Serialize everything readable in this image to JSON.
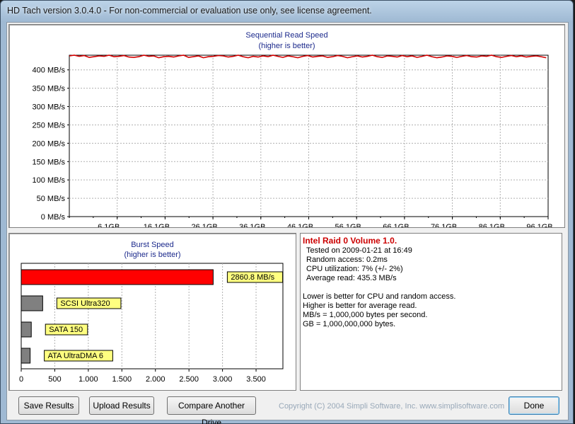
{
  "window": {
    "title": "HD Tach version 3.0.4.0  - For non-commercial or evaluation use only, see license agreement."
  },
  "read_chart": {
    "title": "Sequential Read Speed",
    "subtitle": "(higher is better)",
    "y_ticks": [
      "0 MB/s",
      "50 MB/s",
      "100 MB/s",
      "150 MB/s",
      "200 MB/s",
      "250 MB/s",
      "300 MB/s",
      "350 MB/s",
      "400 MB/s"
    ],
    "x_ticks": [
      "6,1GB",
      "16,1GB",
      "26,1GB",
      "36,1GB",
      "46,1GB",
      "56,1GB",
      "66,1GB",
      "76,1GB",
      "86,1GB",
      "96,1GB"
    ]
  },
  "burst_chart": {
    "title": "Burst Speed",
    "subtitle": "(higher is better)",
    "x_ticks": [
      "0",
      "500",
      "1.000",
      "1.500",
      "2.000",
      "2.500",
      "3.000",
      "3.500"
    ]
  },
  "chart_data": [
    {
      "type": "line",
      "title": "Sequential Read Speed",
      "subtitle": "(higher is better)",
      "ylim": [
        0,
        440
      ],
      "y_unit": "MB/s",
      "x_unit": "GB",
      "xlim": [
        0,
        96.1
      ],
      "series": [
        {
          "color": "#d40000",
          "x": [
            0,
            1,
            2,
            3,
            4,
            5,
            6,
            7,
            8,
            9,
            10,
            11,
            12,
            13,
            14,
            15,
            16,
            17,
            18,
            19,
            20,
            21,
            22,
            23,
            24,
            25,
            26,
            27,
            28,
            29,
            30,
            31,
            32,
            33,
            34,
            35,
            36,
            37,
            38,
            39,
            40,
            41,
            42,
            43,
            44,
            45,
            46,
            47,
            48,
            49,
            50,
            51,
            52,
            53,
            54,
            55,
            56,
            57,
            58,
            59,
            60,
            61,
            62,
            63,
            64,
            65,
            66,
            67,
            68,
            69,
            70,
            71,
            72,
            73,
            74,
            75,
            76,
            77,
            78,
            79,
            80,
            81,
            82,
            83,
            84,
            85,
            86,
            87,
            88,
            89,
            90,
            91,
            92,
            93,
            94,
            95,
            96
          ],
          "values": [
            438,
            440,
            437,
            439,
            434,
            436,
            438,
            437,
            440,
            436,
            437,
            439,
            435,
            434,
            436,
            440,
            437,
            438,
            433,
            436,
            437,
            435,
            438,
            440,
            434,
            436,
            438,
            433,
            436,
            437,
            439,
            438,
            435,
            437,
            440,
            436,
            433,
            437,
            435,
            438,
            436,
            440,
            437,
            434,
            438,
            436,
            433,
            437,
            439,
            435,
            437,
            438,
            434,
            436,
            439,
            437,
            433,
            436,
            438,
            435,
            437,
            440,
            436,
            434,
            438,
            437,
            435,
            439,
            436,
            438,
            434,
            437,
            440,
            436,
            433,
            435,
            438,
            437,
            434,
            437,
            439,
            436,
            435,
            438,
            437,
            440,
            436,
            434,
            437,
            439,
            436,
            438,
            435,
            437,
            438,
            436,
            433
          ]
        }
      ]
    },
    {
      "type": "bar",
      "title": "Burst Speed",
      "subtitle": "(higher is better)",
      "orientation": "horizontal",
      "xlim": [
        0,
        3900
      ],
      "categories": [
        "2860.8 MB/s",
        "SCSI Ultra320",
        "SATA 150",
        "ATA UltraDMA 6"
      ],
      "values": [
        2860.8,
        320,
        150,
        133
      ],
      "colors": [
        "#ff0000",
        "#808080",
        "#808080",
        "#808080"
      ]
    }
  ],
  "info": {
    "title": "Intel Raid 0 Volume 1.0.",
    "tested": "Tested on 2009-01-21 at 16:49",
    "random": "Random access: 0.2ms",
    "cpu": "CPU utilization: 7% (+/- 2%)",
    "avg": "Average read: 435.3 MB/s",
    "note1": "Lower is better for CPU and random access.",
    "note2": "Higher is better for average read.",
    "note3": "MB/s = 1,000,000 bytes per second.",
    "note4": "GB = 1,000,000,000 bytes."
  },
  "buttons": {
    "save": "Save Results",
    "upload": "Upload Results",
    "compare": "Compare Another Drive",
    "done": "Done"
  },
  "footer": {
    "copyright": "Copyright (C) 2004 Simpli Software, Inc. www.simplisoftware.com"
  },
  "colors": {
    "accent_red": "#d40000",
    "title_blue": "#1c2a8c",
    "label_yellow": "#ffff80"
  }
}
